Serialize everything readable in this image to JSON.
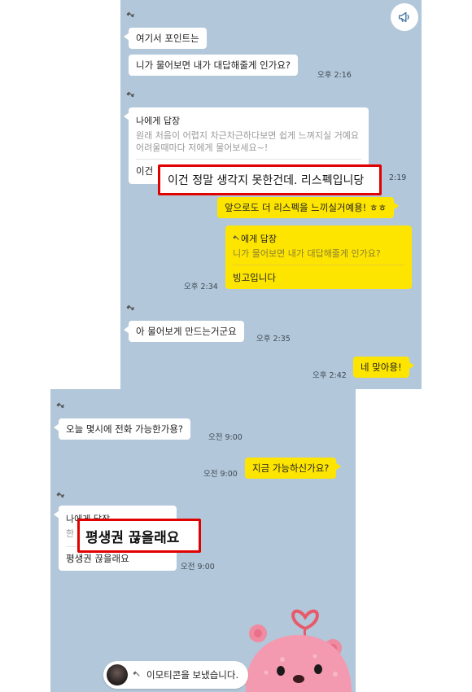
{
  "panel1": {
    "sender_icon": "satellite-icon",
    "message_1": "여기서 포인트는",
    "message_2": "니가 물어보면 내가 대답해줄게 인가요?",
    "time_1": "오후 2:16",
    "reply_card_1": {
      "title": "나에게 답장",
      "quote": "원래 처음이 어렵지 차근차근하다보면 쉽게 느껴지실 거예요 어려울때마다 저에게 물어보세요~!",
      "answer_visible": "이건"
    },
    "time_2": "2:19",
    "highlight_1": "이건 정말 생각지 못한건데. 리스펙입니당",
    "my_message_1": "앞으로도 더 리스펙을 느끼실거예용! ㅎㅎ",
    "reply_card_2": {
      "title": "에게 답장",
      "quote": "니가 물어보면 내가 대답해줄게 인가요?",
      "answer": "빙고입니다"
    },
    "time_3": "오후 2:34",
    "message_3": "아 물어보게 만드는거군요",
    "time_4": "오후 2:35",
    "my_message_2": "네 맞아용!",
    "time_5": "오후 2:42"
  },
  "panel2": {
    "message_1": "오늘 몇시에 전화 가능한가용?",
    "time_1": "오전 9:00",
    "my_message_1": "지금 가능하신가요?",
    "time_2": "오전 9:00",
    "reply_card": {
      "title_partial": "나에게 답장",
      "quote_partial": "한",
      "answer": "평생권 끊을래요"
    },
    "time_3": "오전 9:00",
    "highlight_2": "평생권 끊을래요",
    "emoticon_notice": "이모티콘을 보냈습니다."
  },
  "colors": {
    "chat_background": "#b2c7d9",
    "my_bubble": "#fee500",
    "their_bubble": "#ffffff",
    "highlight_border": "#e00000"
  }
}
